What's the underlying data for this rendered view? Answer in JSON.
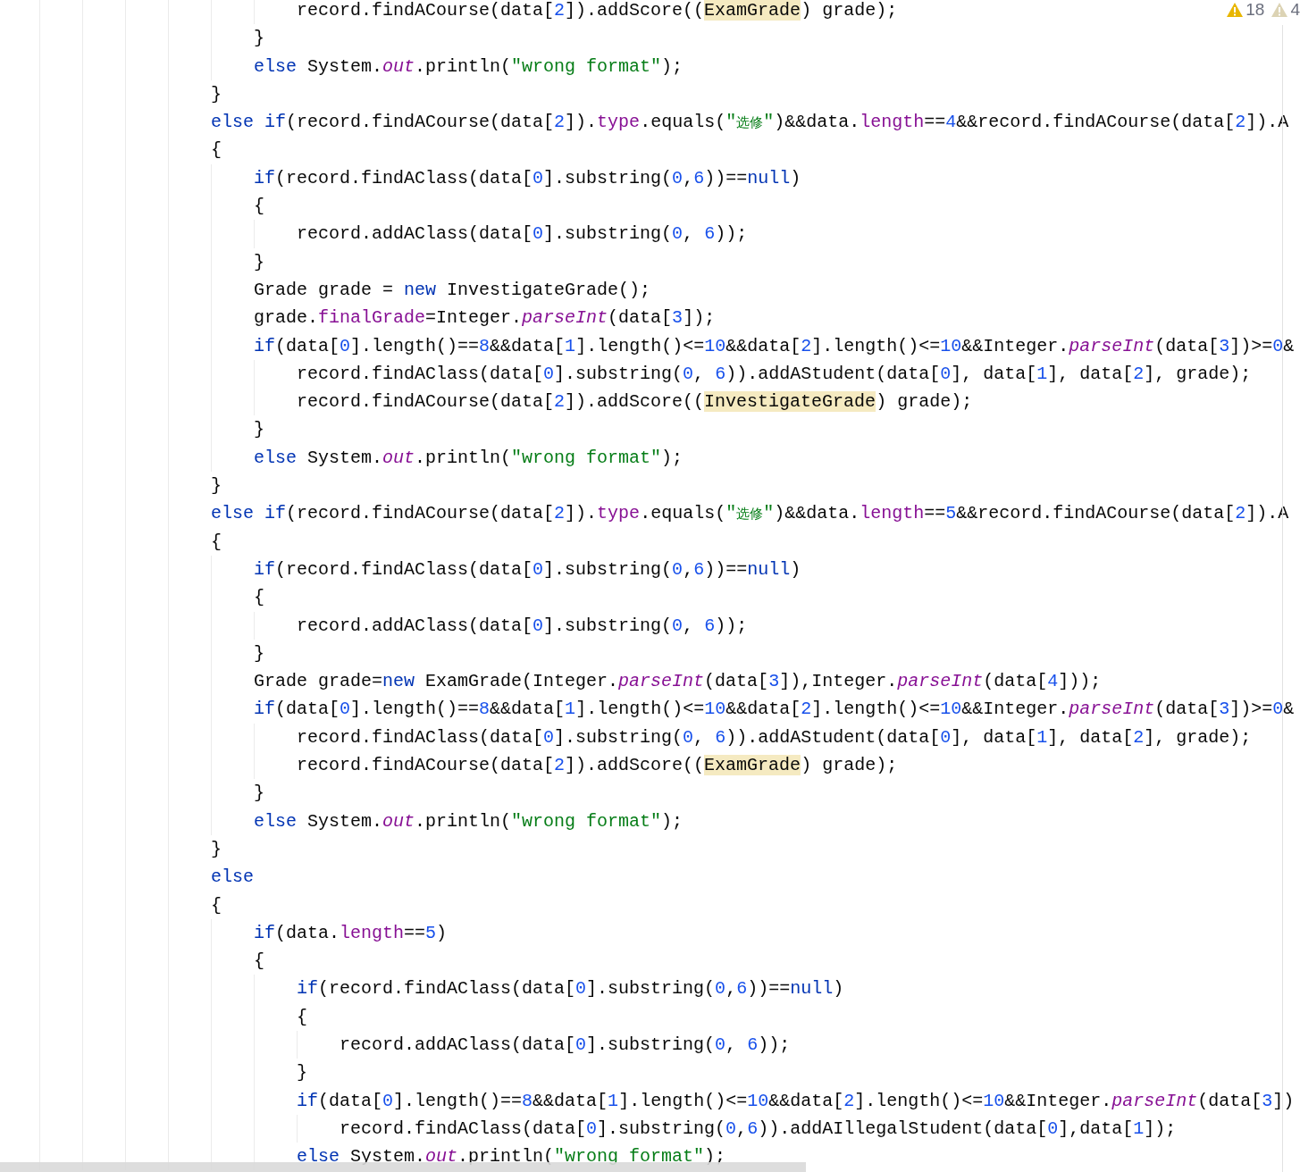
{
  "editor": {
    "inspections": [
      {
        "kind": "warning",
        "count": "18"
      },
      {
        "kind": "weak-warning",
        "count": "4"
      }
    ],
    "lines": [
      {
        "tokens": [
          {
            "kind": "plain",
            "text": "                        record.findACourse(data["
          },
          {
            "kind": "num",
            "text": "2"
          },
          {
            "kind": "plain",
            "text": "]).addScore(("
          },
          {
            "kind": "mark",
            "text": "ExamGrade"
          },
          {
            "kind": "plain",
            "text": ") grade);"
          }
        ]
      },
      {
        "tokens": [
          {
            "kind": "plain",
            "text": "                    }"
          }
        ]
      },
      {
        "tokens": [
          {
            "kind": "kw",
            "text": "                    else"
          },
          {
            "kind": "plain",
            "text": " System."
          },
          {
            "kind": "static",
            "text": "out"
          },
          {
            "kind": "plain",
            "text": ".println("
          },
          {
            "kind": "str",
            "text": "\"wrong format\""
          },
          {
            "kind": "plain",
            "text": ");"
          }
        ]
      },
      {
        "tokens": [
          {
            "kind": "plain",
            "text": "                }"
          }
        ]
      },
      {
        "tokens": [
          {
            "kind": "kw",
            "text": "                else if"
          },
          {
            "kind": "plain",
            "text": "(record.findACourse(data["
          },
          {
            "kind": "num",
            "text": "2"
          },
          {
            "kind": "plain",
            "text": "])."
          },
          {
            "kind": "field",
            "text": "type"
          },
          {
            "kind": "plain",
            "text": ".equals("
          },
          {
            "kind": "str",
            "text": "\"选修\""
          },
          {
            "kind": "plain",
            "text": ")&&data."
          },
          {
            "kind": "field",
            "text": "length"
          },
          {
            "kind": "plain",
            "text": "=="
          },
          {
            "kind": "num",
            "text": "4"
          },
          {
            "kind": "plain",
            "text": "&&record.findACourse(data["
          },
          {
            "kind": "num",
            "text": "2"
          },
          {
            "kind": "plain",
            "text": "]).A"
          }
        ]
      },
      {
        "tokens": [
          {
            "kind": "plain",
            "text": "                {"
          }
        ]
      },
      {
        "tokens": [
          {
            "kind": "kw",
            "text": "                    if"
          },
          {
            "kind": "plain",
            "text": "(record.findAClass(data["
          },
          {
            "kind": "num",
            "text": "0"
          },
          {
            "kind": "plain",
            "text": "].substring("
          },
          {
            "kind": "num",
            "text": "0"
          },
          {
            "kind": "plain",
            "text": ","
          },
          {
            "kind": "num",
            "text": "6"
          },
          {
            "kind": "plain",
            "text": "))=="
          },
          {
            "kind": "kw",
            "text": "null"
          },
          {
            "kind": "plain",
            "text": ")"
          }
        ]
      },
      {
        "tokens": [
          {
            "kind": "plain",
            "text": "                    {"
          }
        ]
      },
      {
        "tokens": [
          {
            "kind": "plain",
            "text": "                        record.addAClass(data["
          },
          {
            "kind": "num",
            "text": "0"
          },
          {
            "kind": "plain",
            "text": "].substring("
          },
          {
            "kind": "num",
            "text": "0"
          },
          {
            "kind": "plain",
            "text": ", "
          },
          {
            "kind": "num",
            "text": "6"
          },
          {
            "kind": "plain",
            "text": "));"
          }
        ]
      },
      {
        "tokens": [
          {
            "kind": "plain",
            "text": "                    }"
          }
        ]
      },
      {
        "tokens": [
          {
            "kind": "plain",
            "text": "                    Grade grade = "
          },
          {
            "kind": "kw",
            "text": "new"
          },
          {
            "kind": "plain",
            "text": " InvestigateGrade();"
          }
        ]
      },
      {
        "tokens": [
          {
            "kind": "plain",
            "text": "                    grade."
          },
          {
            "kind": "field",
            "text": "finalGrade"
          },
          {
            "kind": "plain",
            "text": "=Integer."
          },
          {
            "kind": "static",
            "text": "parseInt"
          },
          {
            "kind": "plain",
            "text": "(data["
          },
          {
            "kind": "num",
            "text": "3"
          },
          {
            "kind": "plain",
            "text": "]);"
          }
        ]
      },
      {
        "tokens": [
          {
            "kind": "kw",
            "text": "                    if"
          },
          {
            "kind": "plain",
            "text": "(data["
          },
          {
            "kind": "num",
            "text": "0"
          },
          {
            "kind": "plain",
            "text": "].length()=="
          },
          {
            "kind": "num",
            "text": "8"
          },
          {
            "kind": "plain",
            "text": "&&data["
          },
          {
            "kind": "num",
            "text": "1"
          },
          {
            "kind": "plain",
            "text": "].length()<="
          },
          {
            "kind": "num",
            "text": "10"
          },
          {
            "kind": "plain",
            "text": "&&data["
          },
          {
            "kind": "num",
            "text": "2"
          },
          {
            "kind": "plain",
            "text": "].length()<="
          },
          {
            "kind": "num",
            "text": "10"
          },
          {
            "kind": "plain",
            "text": "&&Integer."
          },
          {
            "kind": "static",
            "text": "parseInt"
          },
          {
            "kind": "plain",
            "text": "(data["
          },
          {
            "kind": "num",
            "text": "3"
          },
          {
            "kind": "plain",
            "text": "])>="
          },
          {
            "kind": "num",
            "text": "0"
          },
          {
            "kind": "plain",
            "text": "&"
          }
        ]
      },
      {
        "tokens": [
          {
            "kind": "plain",
            "text": "                        record.findAClass(data["
          },
          {
            "kind": "num",
            "text": "0"
          },
          {
            "kind": "plain",
            "text": "].substring("
          },
          {
            "kind": "num",
            "text": "0"
          },
          {
            "kind": "plain",
            "text": ", "
          },
          {
            "kind": "num",
            "text": "6"
          },
          {
            "kind": "plain",
            "text": ")).addAStudent(data["
          },
          {
            "kind": "num",
            "text": "0"
          },
          {
            "kind": "plain",
            "text": "], data["
          },
          {
            "kind": "num",
            "text": "1"
          },
          {
            "kind": "plain",
            "text": "], data["
          },
          {
            "kind": "num",
            "text": "2"
          },
          {
            "kind": "plain",
            "text": "], grade);"
          }
        ]
      },
      {
        "tokens": [
          {
            "kind": "plain",
            "text": "                        record.findACourse(data["
          },
          {
            "kind": "num",
            "text": "2"
          },
          {
            "kind": "plain",
            "text": "]).addScore(("
          },
          {
            "kind": "mark",
            "text": "InvestigateGrade"
          },
          {
            "kind": "plain",
            "text": ") grade);"
          }
        ]
      },
      {
        "tokens": [
          {
            "kind": "plain",
            "text": "                    }"
          }
        ]
      },
      {
        "tokens": [
          {
            "kind": "kw",
            "text": "                    else"
          },
          {
            "kind": "plain",
            "text": " System."
          },
          {
            "kind": "static",
            "text": "out"
          },
          {
            "kind": "plain",
            "text": ".println("
          },
          {
            "kind": "str",
            "text": "\"wrong format\""
          },
          {
            "kind": "plain",
            "text": ");"
          }
        ]
      },
      {
        "tokens": [
          {
            "kind": "plain",
            "text": "                }"
          }
        ]
      },
      {
        "tokens": [
          {
            "kind": "kw",
            "text": "                else if"
          },
          {
            "kind": "plain",
            "text": "(record.findACourse(data["
          },
          {
            "kind": "num",
            "text": "2"
          },
          {
            "kind": "plain",
            "text": "])."
          },
          {
            "kind": "field",
            "text": "type"
          },
          {
            "kind": "plain",
            "text": ".equals("
          },
          {
            "kind": "str",
            "text": "\"选修\""
          },
          {
            "kind": "plain",
            "text": ")&&data."
          },
          {
            "kind": "field",
            "text": "length"
          },
          {
            "kind": "plain",
            "text": "=="
          },
          {
            "kind": "num",
            "text": "5"
          },
          {
            "kind": "plain",
            "text": "&&record.findACourse(data["
          },
          {
            "kind": "num",
            "text": "2"
          },
          {
            "kind": "plain",
            "text": "]).A"
          }
        ]
      },
      {
        "tokens": [
          {
            "kind": "plain",
            "text": "                {"
          }
        ]
      },
      {
        "tokens": [
          {
            "kind": "kw",
            "text": "                    if"
          },
          {
            "kind": "plain",
            "text": "(record.findAClass(data["
          },
          {
            "kind": "num",
            "text": "0"
          },
          {
            "kind": "plain",
            "text": "].substring("
          },
          {
            "kind": "num",
            "text": "0"
          },
          {
            "kind": "plain",
            "text": ","
          },
          {
            "kind": "num",
            "text": "6"
          },
          {
            "kind": "plain",
            "text": "))=="
          },
          {
            "kind": "kw",
            "text": "null"
          },
          {
            "kind": "plain",
            "text": ")"
          }
        ]
      },
      {
        "tokens": [
          {
            "kind": "plain",
            "text": "                    {"
          }
        ]
      },
      {
        "tokens": [
          {
            "kind": "plain",
            "text": "                        record.addAClass(data["
          },
          {
            "kind": "num",
            "text": "0"
          },
          {
            "kind": "plain",
            "text": "].substring("
          },
          {
            "kind": "num",
            "text": "0"
          },
          {
            "kind": "plain",
            "text": ", "
          },
          {
            "kind": "num",
            "text": "6"
          },
          {
            "kind": "plain",
            "text": "));"
          }
        ]
      },
      {
        "tokens": [
          {
            "kind": "plain",
            "text": "                    }"
          }
        ]
      },
      {
        "tokens": [
          {
            "kind": "plain",
            "text": "                    Grade grade="
          },
          {
            "kind": "kw",
            "text": "new"
          },
          {
            "kind": "plain",
            "text": " ExamGrade(Integer."
          },
          {
            "kind": "static",
            "text": "parseInt"
          },
          {
            "kind": "plain",
            "text": "(data["
          },
          {
            "kind": "num",
            "text": "3"
          },
          {
            "kind": "plain",
            "text": "]),Integer."
          },
          {
            "kind": "static",
            "text": "parseInt"
          },
          {
            "kind": "plain",
            "text": "(data["
          },
          {
            "kind": "num",
            "text": "4"
          },
          {
            "kind": "plain",
            "text": "]));"
          }
        ]
      },
      {
        "tokens": [
          {
            "kind": "kw",
            "text": "                    if"
          },
          {
            "kind": "plain",
            "text": "(data["
          },
          {
            "kind": "num",
            "text": "0"
          },
          {
            "kind": "plain",
            "text": "].length()=="
          },
          {
            "kind": "num",
            "text": "8"
          },
          {
            "kind": "plain",
            "text": "&&data["
          },
          {
            "kind": "num",
            "text": "1"
          },
          {
            "kind": "plain",
            "text": "].length()<="
          },
          {
            "kind": "num",
            "text": "10"
          },
          {
            "kind": "plain",
            "text": "&&data["
          },
          {
            "kind": "num",
            "text": "2"
          },
          {
            "kind": "plain",
            "text": "].length()<="
          },
          {
            "kind": "num",
            "text": "10"
          },
          {
            "kind": "plain",
            "text": "&&Integer."
          },
          {
            "kind": "static",
            "text": "parseInt"
          },
          {
            "kind": "plain",
            "text": "(data["
          },
          {
            "kind": "num",
            "text": "3"
          },
          {
            "kind": "plain",
            "text": "])>="
          },
          {
            "kind": "num",
            "text": "0"
          },
          {
            "kind": "plain",
            "text": "&"
          }
        ]
      },
      {
        "tokens": [
          {
            "kind": "plain",
            "text": "                        record.findAClass(data["
          },
          {
            "kind": "num",
            "text": "0"
          },
          {
            "kind": "plain",
            "text": "].substring("
          },
          {
            "kind": "num",
            "text": "0"
          },
          {
            "kind": "plain",
            "text": ", "
          },
          {
            "kind": "num",
            "text": "6"
          },
          {
            "kind": "plain",
            "text": ")).addAStudent(data["
          },
          {
            "kind": "num",
            "text": "0"
          },
          {
            "kind": "plain",
            "text": "], data["
          },
          {
            "kind": "num",
            "text": "1"
          },
          {
            "kind": "plain",
            "text": "], data["
          },
          {
            "kind": "num",
            "text": "2"
          },
          {
            "kind": "plain",
            "text": "], grade);"
          }
        ]
      },
      {
        "tokens": [
          {
            "kind": "plain",
            "text": "                        record.findACourse(data["
          },
          {
            "kind": "num",
            "text": "2"
          },
          {
            "kind": "plain",
            "text": "]).addScore(("
          },
          {
            "kind": "mark",
            "text": "ExamGrade"
          },
          {
            "kind": "plain",
            "text": ") grade);"
          }
        ]
      },
      {
        "tokens": [
          {
            "kind": "plain",
            "text": "                    }"
          }
        ]
      },
      {
        "tokens": [
          {
            "kind": "kw",
            "text": "                    else"
          },
          {
            "kind": "plain",
            "text": " System."
          },
          {
            "kind": "static",
            "text": "out"
          },
          {
            "kind": "plain",
            "text": ".println("
          },
          {
            "kind": "str",
            "text": "\"wrong format\""
          },
          {
            "kind": "plain",
            "text": ");"
          }
        ]
      },
      {
        "tokens": [
          {
            "kind": "plain",
            "text": "                }"
          }
        ]
      },
      {
        "tokens": [
          {
            "kind": "kw",
            "text": "                else"
          }
        ]
      },
      {
        "tokens": [
          {
            "kind": "plain",
            "text": "                {"
          }
        ]
      },
      {
        "tokens": [
          {
            "kind": "kw",
            "text": "                    if"
          },
          {
            "kind": "plain",
            "text": "(data."
          },
          {
            "kind": "field",
            "text": "length"
          },
          {
            "kind": "plain",
            "text": "=="
          },
          {
            "kind": "num",
            "text": "5"
          },
          {
            "kind": "plain",
            "text": ")"
          }
        ]
      },
      {
        "tokens": [
          {
            "kind": "plain",
            "text": "                    {"
          }
        ]
      },
      {
        "tokens": [
          {
            "kind": "kw",
            "text": "                        if"
          },
          {
            "kind": "plain",
            "text": "(record.findAClass(data["
          },
          {
            "kind": "num",
            "text": "0"
          },
          {
            "kind": "plain",
            "text": "].substring("
          },
          {
            "kind": "num",
            "text": "0"
          },
          {
            "kind": "plain",
            "text": ","
          },
          {
            "kind": "num",
            "text": "6"
          },
          {
            "kind": "plain",
            "text": "))=="
          },
          {
            "kind": "kw",
            "text": "null"
          },
          {
            "kind": "plain",
            "text": ")"
          }
        ]
      },
      {
        "tokens": [
          {
            "kind": "plain",
            "text": "                        {"
          }
        ]
      },
      {
        "tokens": [
          {
            "kind": "plain",
            "text": "                            record.addAClass(data["
          },
          {
            "kind": "num",
            "text": "0"
          },
          {
            "kind": "plain",
            "text": "].substring("
          },
          {
            "kind": "num",
            "text": "0"
          },
          {
            "kind": "plain",
            "text": ", "
          },
          {
            "kind": "num",
            "text": "6"
          },
          {
            "kind": "plain",
            "text": "));"
          }
        ]
      },
      {
        "tokens": [
          {
            "kind": "plain",
            "text": "                        }"
          }
        ]
      },
      {
        "tokens": [
          {
            "kind": "kw",
            "text": "                        if"
          },
          {
            "kind": "plain",
            "text": "(data["
          },
          {
            "kind": "num",
            "text": "0"
          },
          {
            "kind": "plain",
            "text": "].length()=="
          },
          {
            "kind": "num",
            "text": "8"
          },
          {
            "kind": "plain",
            "text": "&&data["
          },
          {
            "kind": "num",
            "text": "1"
          },
          {
            "kind": "plain",
            "text": "].length()<="
          },
          {
            "kind": "num",
            "text": "10"
          },
          {
            "kind": "plain",
            "text": "&&data["
          },
          {
            "kind": "num",
            "text": "2"
          },
          {
            "kind": "plain",
            "text": "].length()<="
          },
          {
            "kind": "num",
            "text": "10"
          },
          {
            "kind": "plain",
            "text": "&&Integer."
          },
          {
            "kind": "static",
            "text": "parseInt"
          },
          {
            "kind": "plain",
            "text": "(data["
          },
          {
            "kind": "num",
            "text": "3"
          },
          {
            "kind": "plain",
            "text": "])"
          }
        ]
      },
      {
        "tokens": [
          {
            "kind": "plain",
            "text": "                            record.findAClass(data["
          },
          {
            "kind": "num",
            "text": "0"
          },
          {
            "kind": "plain",
            "text": "].substring("
          },
          {
            "kind": "num",
            "text": "0"
          },
          {
            "kind": "plain",
            "text": ","
          },
          {
            "kind": "num",
            "text": "6"
          },
          {
            "kind": "plain",
            "text": ")).addAIllegalStudent(data["
          },
          {
            "kind": "num",
            "text": "0"
          },
          {
            "kind": "plain",
            "text": "],data["
          },
          {
            "kind": "num",
            "text": "1"
          },
          {
            "kind": "plain",
            "text": "]);"
          }
        ]
      },
      {
        "tokens": [
          {
            "kind": "kw",
            "text": "                        else"
          },
          {
            "kind": "plain",
            "text": " System."
          },
          {
            "kind": "static",
            "text": "out"
          },
          {
            "kind": "plain",
            "text": ".println("
          },
          {
            "kind": "str",
            "text": "\"wrong format\""
          },
          {
            "kind": "plain",
            "text": ");"
          }
        ]
      }
    ]
  }
}
